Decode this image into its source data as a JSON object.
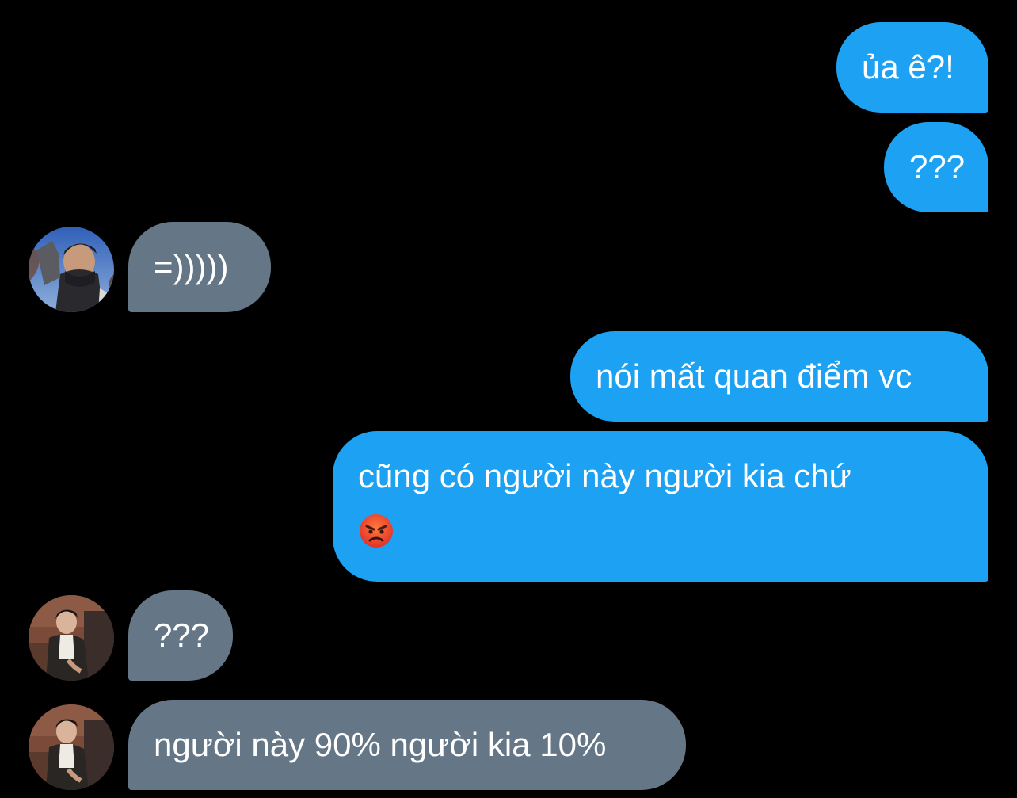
{
  "messages": [
    {
      "direction": "out",
      "text": "ủa ê?!"
    },
    {
      "direction": "out",
      "text": "???"
    },
    {
      "direction": "in",
      "text": "=)))))",
      "avatar": "avatar-masked-person"
    },
    {
      "direction": "out",
      "text": "nói mất quan điểm vc"
    },
    {
      "direction": "out",
      "text": "cũng có người này người kia chứ",
      "emoji": "angry-face-emoji"
    },
    {
      "direction": "in",
      "text": "???",
      "avatar": "avatar-person-portrait"
    },
    {
      "direction": "in",
      "text": "người này 90% người kia 10%",
      "avatar": "avatar-person-portrait"
    }
  ],
  "colors": {
    "background": "#000000",
    "outgoing_bubble": "#1da1f2",
    "incoming_bubble": "#657786",
    "text": "#ffffff"
  }
}
